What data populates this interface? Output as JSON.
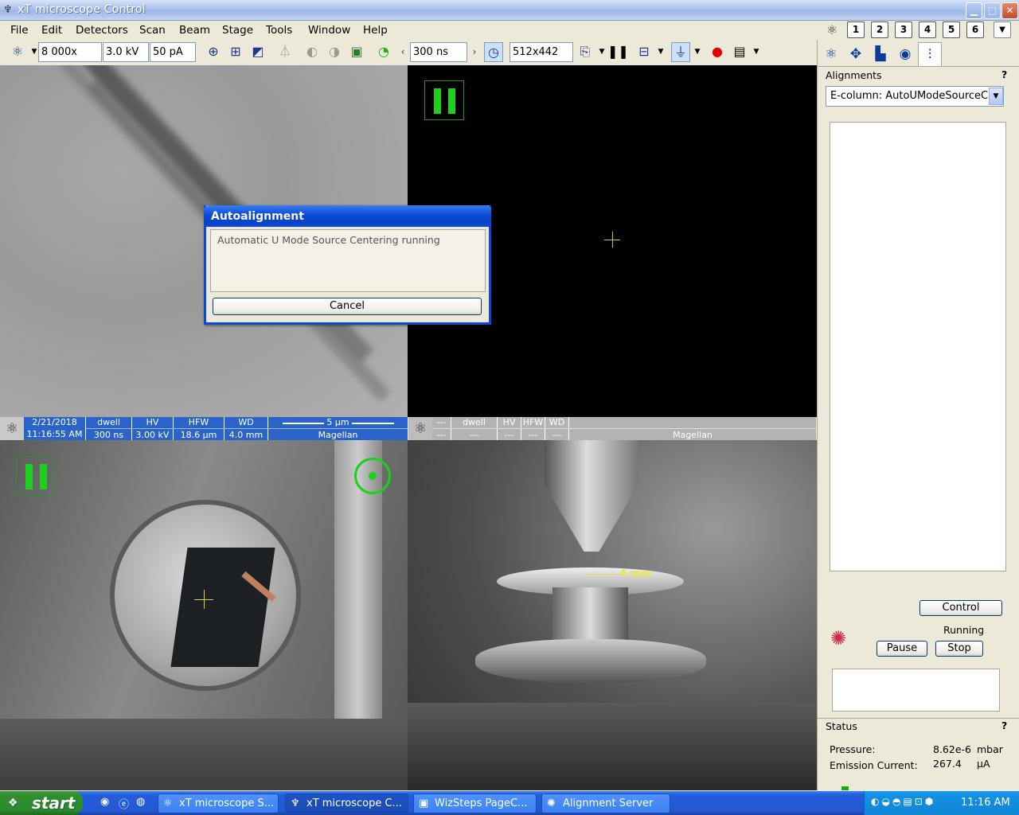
{
  "window": {
    "title": "xT microscope Control",
    "minimize": "▁",
    "maximize": "□",
    "close": "✕"
  },
  "menu": [
    "File",
    "Edit",
    "Detectors",
    "Scan",
    "Beam",
    "Stage",
    "Tools",
    "Window",
    "Help"
  ],
  "window_buttons": [
    "1",
    "2",
    "3",
    "4",
    "5",
    "6"
  ],
  "toolbar": {
    "magnification": "8 000x",
    "high_voltage": "3.0 kV",
    "beam_current": "50 pA",
    "dwell": "300 ns",
    "resolution": "512x442"
  },
  "quad1_databar": {
    "date": "2/21/2018",
    "time": "11:16:55 AM",
    "dwell_label": "dwell",
    "dwell_value": "300 ns",
    "hv_label": "HV",
    "hv_value": "3.00 kV",
    "hfw_label": "HFW",
    "hfw_value": "18.6 µm",
    "wd_label": "WD",
    "wd_value": "4.0 mm",
    "scalebar": "5 µm",
    "instrument": "Magellan"
  },
  "quad2_databar": {
    "c1": "---",
    "c1b": "---",
    "dwell_label": "dwell",
    "dwell_value": "---",
    "hv_label": "HV",
    "hv_value": "---",
    "hfw_label": "HFW",
    "hfw_value": "---",
    "wd_label": "WD",
    "wd_value": "---",
    "instrument": "Magellan"
  },
  "chamber_label": "4 mm",
  "dialog": {
    "title": "Autoalignment",
    "message": "Automatic U Mode Source Centering running",
    "cancel": "Cancel"
  },
  "right_panel": {
    "alignments_title": "Alignments",
    "help": "?",
    "alignment_selected": "E-column: AutoUModeSourceCe",
    "control_button": "Control",
    "state": "Running",
    "pause_button": "Pause",
    "stop_button": "Stop",
    "status_title": "Status",
    "status_help": "?",
    "pressure_label": "Pressure:",
    "pressure_value": "8.62e-6",
    "pressure_unit": "mbar",
    "emission_label": "Emission Current:",
    "emission_value": "267.4",
    "emission_unit": "µA"
  },
  "taskbar": {
    "start": "start",
    "tasks": [
      "xT microscope S...",
      "xT microscope C...",
      "WizSteps PageC...",
      "Alignment Server"
    ],
    "clock": "11:16 AM"
  },
  "colors": {
    "databar_blue": "#2b64c8",
    "pause_green": "#1bd11b",
    "dialog_blue": "#0a4ad6"
  },
  "icons": [
    "app-atom-icon",
    "crosshair-icon",
    "pause-icon",
    "record-icon",
    "alignment-status-icon"
  ]
}
